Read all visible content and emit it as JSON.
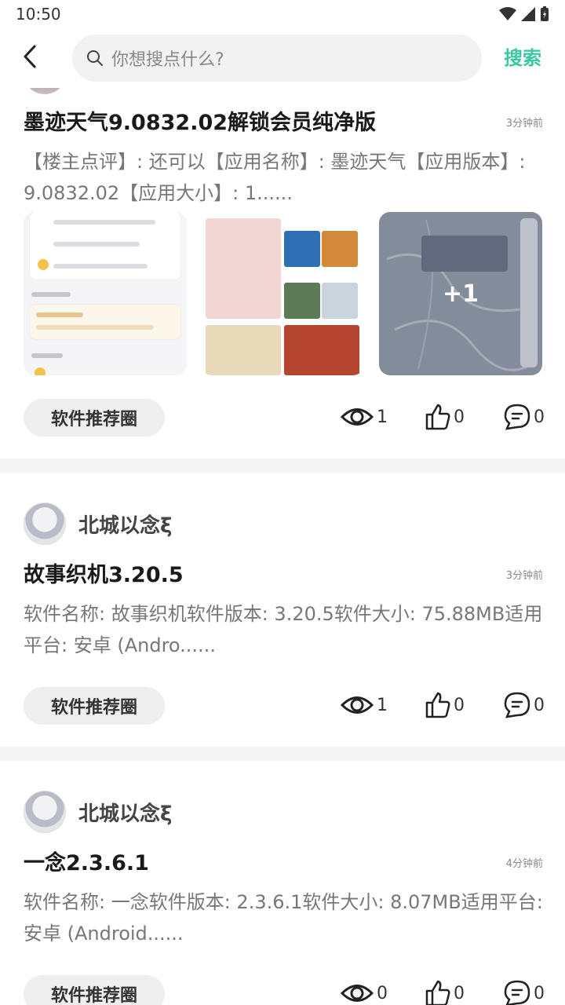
{
  "status_bar": {
    "time": "10:50"
  },
  "header": {
    "search_placeholder": "你想搜点什么?",
    "search_button": "搜索"
  },
  "posts": [
    {
      "title": "墨迹天气9.0832.02解锁会员纯净版",
      "time": "3分钟前",
      "body": "【楼主点评】: 还可以【应用名称】: 墨迹天气【应用版本】: 9.0832.02【应用大小】: 1......",
      "more_images": "+1",
      "tag": "软件推荐圈",
      "views": "1",
      "likes": "0",
      "comments": "0"
    },
    {
      "user": "北城以念ξ",
      "title": "故事织机3.20.5",
      "time": "3分钟前",
      "body": "软件名称: 故事织机软件版本: 3.20.5软件大小: 75.88MB适用平台: 安卓 (Andro......",
      "tag": "软件推荐圈",
      "views": "1",
      "likes": "0",
      "comments": "0"
    },
    {
      "user": "北城以念ξ",
      "title": "一念2.3.6.1",
      "time": "4分钟前",
      "body": "软件名称: 一念软件版本: 2.3.6.1软件大小: 8.07MB适用平台: 安卓 (Android......",
      "tag": "软件推荐圈",
      "views": "0",
      "likes": "0",
      "comments": "0"
    }
  ],
  "colors": {
    "accent": "#3cc8a3",
    "muted_text": "#777777",
    "divider": "#f4f4f4"
  }
}
